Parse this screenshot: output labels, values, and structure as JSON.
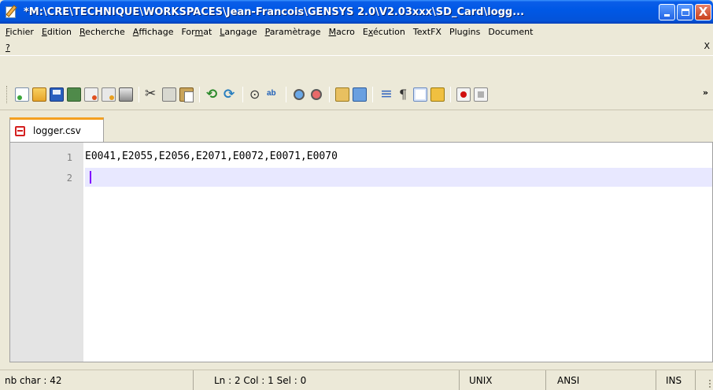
{
  "window": {
    "title": "*M:\\CRE\\TECHNIQUE\\WORKSPACES\\Jean-Francois\\GENSYS 2.0\\V2.03xxx\\SD_Card\\logg...",
    "close_glyph": "X"
  },
  "menu": {
    "row1": [
      {
        "pre": "",
        "accel": "F",
        "post": "ichier"
      },
      {
        "pre": "",
        "accel": "E",
        "post": "dition"
      },
      {
        "pre": "",
        "accel": "R",
        "post": "echerche"
      },
      {
        "pre": "",
        "accel": "A",
        "post": "ffichage"
      },
      {
        "pre": "For",
        "accel": "m",
        "post": "at"
      },
      {
        "pre": "",
        "accel": "L",
        "post": "angage"
      },
      {
        "pre": "",
        "accel": "P",
        "post": "aramètrage"
      },
      {
        "pre": "",
        "accel": "M",
        "post": "acro"
      },
      {
        "pre": "E",
        "accel": "x",
        "post": "écution"
      },
      {
        "pre": "TextFX",
        "accel": "",
        "post": ""
      },
      {
        "pre": "Plugins",
        "accel": "",
        "post": ""
      },
      {
        "pre": "Document",
        "accel": "",
        "post": ""
      }
    ],
    "help": "?",
    "close_doc": "X"
  },
  "toolbar": {
    "overflow": "»",
    "icons": [
      "new-file-icon",
      "open-file-icon",
      "save-icon",
      "save-all-icon",
      "close-icon",
      "close-all-icon",
      "print-icon",
      "cut-icon",
      "copy-icon",
      "paste-icon",
      "undo-icon",
      "redo-icon",
      "find-icon",
      "replace-icon",
      "zoom-in-icon",
      "zoom-out-icon",
      "sync-vertical-icon",
      "sync-horizontal-icon",
      "word-wrap-icon",
      "show-all-chars-icon",
      "indent-guide-icon",
      "fold-icon",
      "record-macro-icon",
      "stop-macro-icon"
    ]
  },
  "tabs": [
    {
      "label": "logger.csv",
      "active": true
    }
  ],
  "editor": {
    "lines": [
      {
        "number": "1",
        "text": "E0041,E2055,E2056,E2071,E0072,E0071,E0070"
      },
      {
        "number": "2",
        "text": ""
      }
    ],
    "current_line": 2
  },
  "status": {
    "nb_char": "nb char : 42",
    "position": "Ln : 2    Col : 1    Sel : 0",
    "eol": "UNIX",
    "encoding": "ANSI",
    "mode": "INS"
  }
}
